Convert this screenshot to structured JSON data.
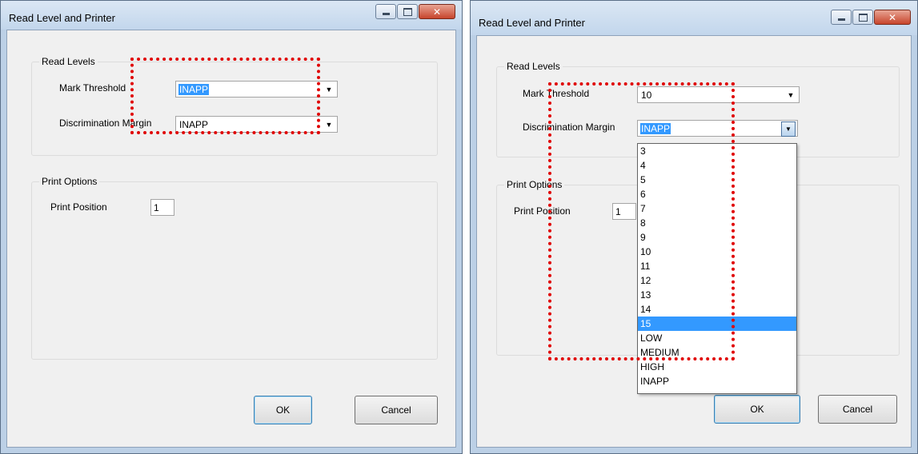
{
  "left_window": {
    "title": "Read Level and Printer",
    "read_levels_label": "Read Levels",
    "mark_threshold_label": "Mark Threshold",
    "mark_threshold_value": "INAPP",
    "discrimination_margin_label": "Discrimination Margin",
    "discrimination_margin_value": "INAPP",
    "print_options_label": "Print Options",
    "print_position_label": "Print Position",
    "print_position_value": "1",
    "ok_label": "OK",
    "cancel_label": "Cancel"
  },
  "right_window": {
    "title": "Read Level and Printer",
    "read_levels_label": "Read Levels",
    "mark_threshold_label": "Mark Threshold",
    "mark_threshold_value": "10",
    "discrimination_margin_label": "Discrimination Margin",
    "discrimination_margin_value": "INAPP",
    "print_options_label": "Print Options",
    "print_position_label": "Print Position",
    "print_position_value": "1",
    "ok_label": "OK",
    "cancel_label": "Cancel",
    "dropdown_items": [
      "3",
      "4",
      "5",
      "6",
      "7",
      "8",
      "9",
      "10",
      "11",
      "12",
      "13",
      "14",
      "15",
      "LOW",
      "MEDIUM",
      "HIGH",
      "INAPP"
    ],
    "dropdown_highlighted": "15"
  },
  "colors": {
    "selection": "#3399ff",
    "annotation": "#e00000",
    "dialog_bg": "#f0f0f0"
  },
  "icons": [
    "minimize-icon",
    "maximize-icon",
    "close-icon",
    "chevron-down-icon"
  ]
}
